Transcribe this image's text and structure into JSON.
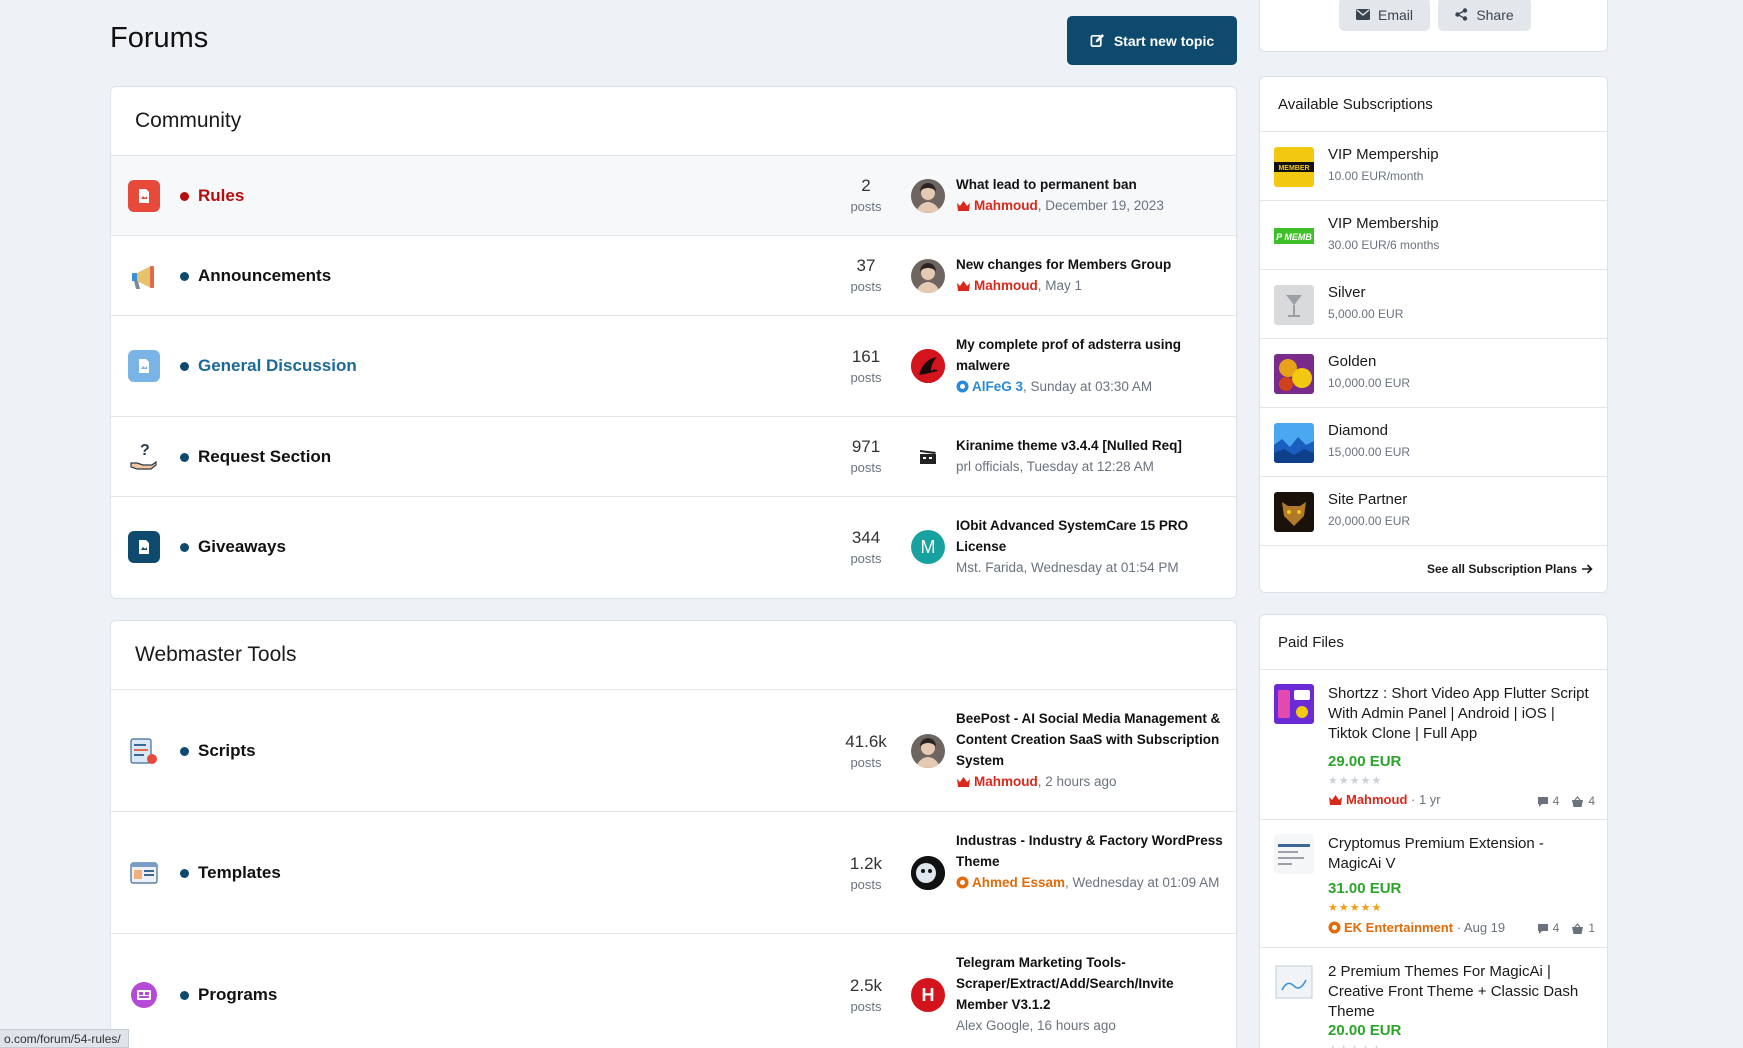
{
  "header": {
    "title": "Forums",
    "new_topic_label": "Start new topic"
  },
  "share": {
    "email_label": "Email",
    "share_label": "Share"
  },
  "community": {
    "title": "Community",
    "rows": [
      {
        "title": "Rules",
        "count": "2",
        "count_label": "posts",
        "last_title": "What lead to permanent ban",
        "user": "Mahmoud",
        "date": ", December 19, 2023"
      },
      {
        "title": "Announcements",
        "count": "37",
        "count_label": "posts",
        "last_title": "New changes for Members Group",
        "user": "Mahmoud",
        "date": ", May 1"
      },
      {
        "title": "General Discussion",
        "count": "161",
        "count_label": "posts",
        "last_title": "My complete prof of adsterra using malwere",
        "user": "AlFeG 3",
        "date": ", Sunday at 03:30 AM"
      },
      {
        "title": "Request Section",
        "count": "971",
        "count_label": "posts",
        "last_title": "Kiranime theme v3.4.4 [Nulled Req]",
        "meta": "prl officials, Tuesday at 12:28 AM"
      },
      {
        "title": "Giveaways",
        "count": "344",
        "count_label": "posts",
        "last_title": "IObit Advanced SystemCare 15 PRO License",
        "meta": "Mst. Farida, Wednesday at 01:54 PM",
        "avatar_letter": "M"
      }
    ]
  },
  "webmaster": {
    "title": "Webmaster Tools",
    "rows": [
      {
        "title": "Scripts",
        "count": "41.6k",
        "count_label": "posts",
        "last_title": "BeePost - AI Social Media Management & Content Creation SaaS with Subscription System",
        "user": "Mahmoud",
        "date": ", 2 hours ago"
      },
      {
        "title": "Templates",
        "count": "1.2k",
        "count_label": "posts",
        "last_title": "Industras - Industry & Factory WordPress Theme",
        "user": "Ahmed Essam",
        "date": ", Wednesday at 01:09 AM"
      },
      {
        "title": "Programs",
        "count": "2.5k",
        "count_label": "posts",
        "last_title": "Telegram Marketing Tools-Scraper/Extract/Add/Search/Invite Member V3.1.2",
        "meta": "Alex Google, 16 hours ago",
        "avatar_letter": "H"
      }
    ]
  },
  "subscriptions": {
    "title": "Available Subscriptions",
    "items": [
      {
        "name": "VIP Mempership",
        "price": "10.00 EUR/month"
      },
      {
        "name": "VIP Membership",
        "price": "30.00 EUR/6 months"
      },
      {
        "name": "Silver",
        "price": "5,000.00 EUR"
      },
      {
        "name": "Golden",
        "price": "10,000.00 EUR"
      },
      {
        "name": "Diamond",
        "price": "15,000.00 EUR"
      },
      {
        "name": "Site Partner",
        "price": "20,000.00 EUR"
      }
    ],
    "see_all": "See all Subscription Plans"
  },
  "paid_files": {
    "title": "Paid Files",
    "items": [
      {
        "title": "Shortzz : Short Video App Flutter Script With Admin Panel | Android | iOS | Tiktok Clone | Full App",
        "price": "29.00 EUR",
        "rating": 0,
        "user": "Mahmoud",
        "age": "· 1 yr",
        "comments": "4",
        "downloads": "4"
      },
      {
        "title": "Cryptomus Premium Extension - MagicAi V",
        "price": "31.00 EUR",
        "rating": 5,
        "user": "EK Entertainment",
        "age": "· Aug 19",
        "comments": "4",
        "downloads": "1"
      },
      {
        "title": "2 Premium Themes For MagicAi | Creative Front Theme + Classic Dash Theme",
        "price": "20.00 EUR",
        "rating": 0
      }
    ]
  },
  "status_bar": {
    "url": "o.com/forum/54-rules/"
  },
  "colors": {
    "brand": "#0e4a6e",
    "rules_red": "#b50d0d",
    "general_blue": "#1a6a9a",
    "price_green": "#2aa52a",
    "admin_red": "#d9291b"
  }
}
